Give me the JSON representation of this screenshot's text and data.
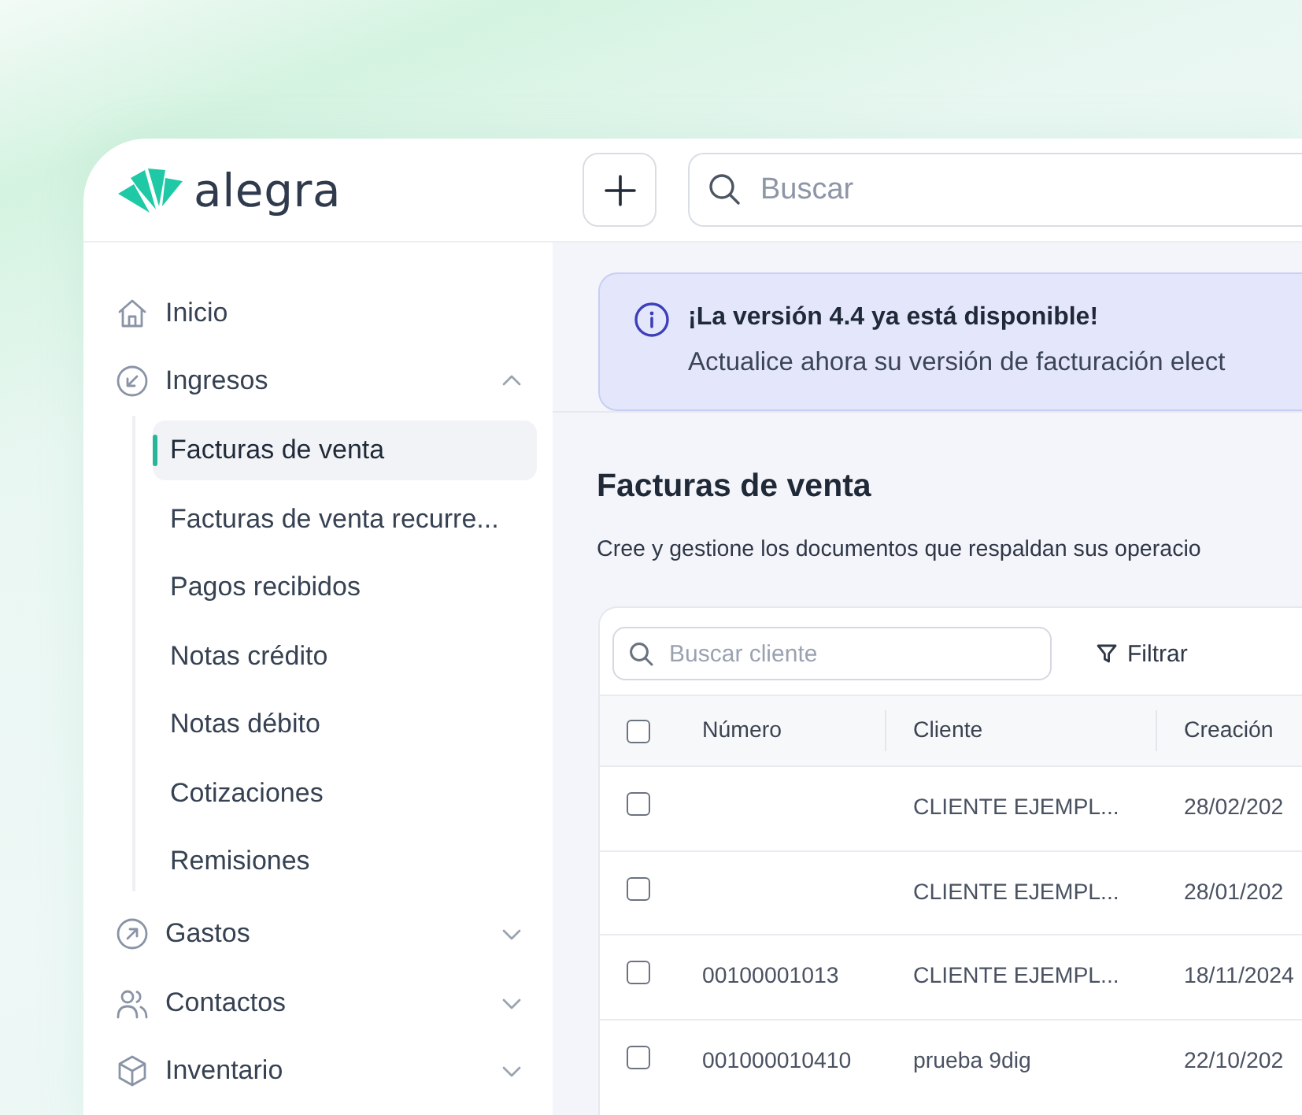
{
  "logo": {
    "text": "alegra"
  },
  "header": {
    "search": {
      "placeholder": "Buscar"
    }
  },
  "sidebar": {
    "items": [
      {
        "kind": "link",
        "label": "Inicio"
      },
      {
        "kind": "group",
        "label": "Ingresos",
        "expanded": true,
        "children": [
          {
            "label": "Facturas de venta",
            "selected": true
          },
          {
            "label": "Facturas de venta recurre...",
            "selected": false
          },
          {
            "label": "Pagos recibidos",
            "selected": false
          },
          {
            "label": "Notas crédito",
            "selected": false
          },
          {
            "label": "Notas débito",
            "selected": false
          },
          {
            "label": "Cotizaciones",
            "selected": false
          },
          {
            "label": "Remisiones",
            "selected": false
          }
        ]
      },
      {
        "kind": "group",
        "label": "Gastos",
        "expanded": false
      },
      {
        "kind": "group",
        "label": "Contactos",
        "expanded": false
      },
      {
        "kind": "group",
        "label": "Inventario",
        "expanded": false
      }
    ]
  },
  "banner": {
    "title": "¡La versión 4.4 ya está disponible!",
    "message": "Actualice ahora su versión de facturación elect"
  },
  "page": {
    "title": "Facturas de venta",
    "description": "Cree y gestione los documentos que respaldan sus operacio"
  },
  "table": {
    "search": {
      "placeholder": "Buscar cliente"
    },
    "filter_button": "Filtrar",
    "header_checked": false,
    "columns": [
      "Número",
      "Cliente",
      "Creación"
    ],
    "rows": [
      {
        "checked": false,
        "client": "CLIENTE EJEMPL...",
        "created": "28/02/202"
      },
      {
        "checked": false,
        "client": "CLIENTE EJEMPL...",
        "created": "28/01/202"
      },
      {
        "checked": false,
        "number": "00100001013",
        "client": "CLIENTE EJEMPL...",
        "created": "18/11/2024"
      },
      {
        "checked": false,
        "number": "001000010410",
        "client": "prueba 9dig",
        "created": "22/10/202"
      }
    ]
  }
}
